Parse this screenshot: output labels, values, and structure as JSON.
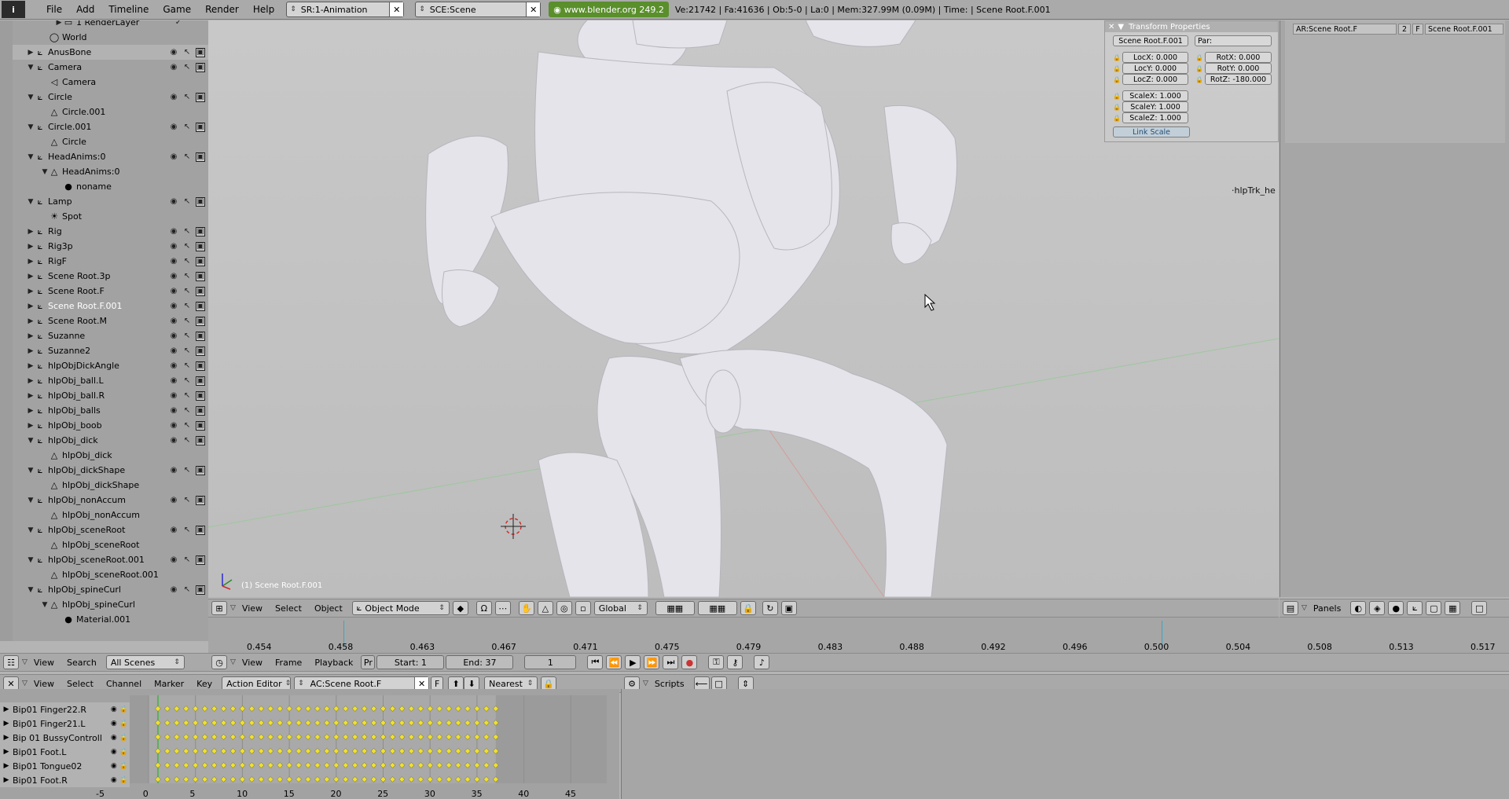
{
  "topbar": {
    "menu": [
      "File",
      "Add",
      "Timeline",
      "Game",
      "Render",
      "Help"
    ],
    "screen_field": "SR:1-Animation",
    "scene_field": "SCE:Scene",
    "site_link": "www.blender.org 249.2",
    "stats": "Ve:21742 | Fa:41636 | Ob:5-0 | La:0  | Mem:327.99M (0.09M)  | Time:  | Scene Root.F.001"
  },
  "outliner": {
    "rows": [
      {
        "name": "1 RenderLayer",
        "indent": 2,
        "icon": "renderlayer-icon",
        "glyph": "▭",
        "tri": "▶",
        "check": "✓"
      },
      {
        "name": "World",
        "indent": 1,
        "icon": "world-icon",
        "glyph": "◯",
        "tri": ""
      },
      {
        "name": "AnusBone",
        "indent": 0,
        "icon": "armature-icon",
        "glyph": "⟀",
        "tri": "▶"
      },
      {
        "name": "Camera",
        "indent": 0,
        "icon": "object-icon",
        "glyph": "⟀",
        "tri": "▼"
      },
      {
        "name": "Camera",
        "indent": 1,
        "icon": "camera-icon",
        "glyph": "◁",
        "tri": ""
      },
      {
        "name": "Circle",
        "indent": 0,
        "icon": "object-icon",
        "glyph": "⟀",
        "tri": "▼"
      },
      {
        "name": "Circle.001",
        "indent": 1,
        "icon": "mesh-icon",
        "glyph": "△",
        "tri": ""
      },
      {
        "name": "Circle.001",
        "indent": 0,
        "icon": "object-icon",
        "glyph": "⟀",
        "tri": "▼"
      },
      {
        "name": "Circle",
        "indent": 1,
        "icon": "mesh-icon",
        "glyph": "△",
        "tri": ""
      },
      {
        "name": "HeadAnims:0",
        "indent": 0,
        "icon": "object-icon",
        "glyph": "⟀",
        "tri": "▼"
      },
      {
        "name": "HeadAnims:0",
        "indent": 1,
        "icon": "mesh-icon",
        "glyph": "△",
        "tri": "▼"
      },
      {
        "name": "noname",
        "indent": 2,
        "icon": "material-icon",
        "glyph": "●",
        "tri": ""
      },
      {
        "name": "Lamp",
        "indent": 0,
        "icon": "object-icon",
        "glyph": "⟀",
        "tri": "▼"
      },
      {
        "name": "Spot",
        "indent": 1,
        "icon": "lamp-icon",
        "glyph": "☀",
        "tri": ""
      },
      {
        "name": "Rig",
        "indent": 0,
        "icon": "armature-icon",
        "glyph": "⟀",
        "tri": "▶"
      },
      {
        "name": "Rig3p",
        "indent": 0,
        "icon": "armature-icon",
        "glyph": "⟀",
        "tri": "▶"
      },
      {
        "name": "RigF",
        "indent": 0,
        "icon": "armature-icon",
        "glyph": "⟀",
        "tri": "▶"
      },
      {
        "name": "Scene Root.3p",
        "indent": 0,
        "icon": "armature-icon",
        "glyph": "⟀",
        "tri": "▶"
      },
      {
        "name": "Scene Root.F",
        "indent": 0,
        "icon": "armature-icon",
        "glyph": "⟀",
        "tri": "▶"
      },
      {
        "name": "Scene Root.F.001",
        "indent": 0,
        "icon": "armature-icon",
        "glyph": "⟀",
        "tri": "▶",
        "selected": true
      },
      {
        "name": "Scene Root.M",
        "indent": 0,
        "icon": "armature-icon",
        "glyph": "⟀",
        "tri": "▶"
      },
      {
        "name": "Suzanne",
        "indent": 0,
        "icon": "object-icon",
        "glyph": "⟀",
        "tri": "▶"
      },
      {
        "name": "Suzanne2",
        "indent": 0,
        "icon": "object-icon",
        "glyph": "⟀",
        "tri": "▶"
      },
      {
        "name": "hlpObjDickAngle",
        "indent": 0,
        "icon": "object-icon",
        "glyph": "⟀",
        "tri": "▶"
      },
      {
        "name": "hlpObj_ball.L",
        "indent": 0,
        "icon": "object-icon",
        "glyph": "⟀",
        "tri": "▶"
      },
      {
        "name": "hlpObj_ball.R",
        "indent": 0,
        "icon": "object-icon",
        "glyph": "⟀",
        "tri": "▶"
      },
      {
        "name": "hlpObj_balls",
        "indent": 0,
        "icon": "object-icon",
        "glyph": "⟀",
        "tri": "▶"
      },
      {
        "name": "hlpObj_boob",
        "indent": 0,
        "icon": "object-icon",
        "glyph": "⟀",
        "tri": "▶"
      },
      {
        "name": "hlpObj_dick",
        "indent": 0,
        "icon": "object-icon",
        "glyph": "⟀",
        "tri": "▼"
      },
      {
        "name": "hlpObj_dick",
        "indent": 1,
        "icon": "mesh-icon",
        "glyph": "△",
        "tri": ""
      },
      {
        "name": "hlpObj_dickShape",
        "indent": 0,
        "icon": "object-icon",
        "glyph": "⟀",
        "tri": "▼"
      },
      {
        "name": "hlpObj_dickShape",
        "indent": 1,
        "icon": "mesh-icon",
        "glyph": "△",
        "tri": ""
      },
      {
        "name": "hlpObj_nonAccum",
        "indent": 0,
        "icon": "object-icon",
        "glyph": "⟀",
        "tri": "▼"
      },
      {
        "name": "hlpObj_nonAccum",
        "indent": 1,
        "icon": "mesh-icon",
        "glyph": "△",
        "tri": ""
      },
      {
        "name": "hlpObj_sceneRoot",
        "indent": 0,
        "icon": "object-icon",
        "glyph": "⟀",
        "tri": "▼"
      },
      {
        "name": "hlpObj_sceneRoot",
        "indent": 1,
        "icon": "mesh-icon",
        "glyph": "△",
        "tri": ""
      },
      {
        "name": "hlpObj_sceneRoot.001",
        "indent": 0,
        "icon": "object-icon",
        "glyph": "⟀",
        "tri": "▼"
      },
      {
        "name": "hlpObj_sceneRoot.001",
        "indent": 1,
        "icon": "mesh-icon",
        "glyph": "△",
        "tri": ""
      },
      {
        "name": "hlpObj_spineCurl",
        "indent": 0,
        "icon": "object-icon",
        "glyph": "⟀",
        "tri": "▼"
      },
      {
        "name": "hlpObj_spineCurl",
        "indent": 1,
        "icon": "mesh-icon",
        "glyph": "△",
        "tri": "▼"
      },
      {
        "name": "Material.001",
        "indent": 2,
        "icon": "material-icon",
        "glyph": "●",
        "tri": ""
      }
    ]
  },
  "viewport": {
    "object_label": "(1) Scene Root.F.001",
    "helper_label": "hlpTrk_he"
  },
  "transform_panel": {
    "title": "Transform Properties",
    "ob_name": "Scene Root.F.001",
    "parent": "Par:",
    "loc": [
      "LocX: 0.000",
      "LocY: 0.000",
      "LocZ: 0.000"
    ],
    "rot": [
      "RotX: 0.000",
      "RotY: 0.000",
      "RotZ: -180.000"
    ],
    "scale": [
      "ScaleX: 1.000",
      "ScaleY: 1.000",
      "ScaleZ: 1.000"
    ],
    "link_scale": "Link Scale"
  },
  "right_panel": {
    "ar_field": "AR:Scene Root.F",
    "users": "2",
    "f": "F",
    "ob_field": "Scene Root.F.001"
  },
  "view3d_header": {
    "menus": [
      "View",
      "Select",
      "Object"
    ],
    "mode": "Object Mode",
    "orientation": "Global"
  },
  "buttons_header": {
    "panels_label": "Panels"
  },
  "ruler": {
    "ticks": [
      "0.454",
      "0.458",
      "0.463",
      "0.467",
      "0.471",
      "0.475",
      "0.479",
      "0.483",
      "0.488",
      "0.492",
      "0.496",
      "0.500",
      "0.504",
      "0.508",
      "0.513",
      "0.517"
    ]
  },
  "outliner_header": {
    "menus": [
      "View",
      "Search"
    ],
    "scenes": "All Scenes"
  },
  "timeline_header": {
    "menus": [
      "View",
      "Frame",
      "Playback"
    ],
    "pr": "Pr",
    "start": "Start: 1",
    "end": "End: 37",
    "current": "1"
  },
  "action_header": {
    "menus": [
      "View",
      "Select",
      "Channel",
      "Marker",
      "Key"
    ],
    "mode": "Action Editor",
    "action": "AC:Scene Root.F",
    "f": "F",
    "interp": "Nearest"
  },
  "scripts_header": {
    "label": "Scripts"
  },
  "action_channels": [
    "Bip01 Finger22.R",
    "Bip01 Finger21.L",
    "Bip 01 BussyControll",
    "Bip01 Foot.L",
    "Bip01 Tongue02",
    "Bip01 Foot.R"
  ],
  "action_ticks": [
    "-5",
    "0",
    "5",
    "10",
    "15",
    "20",
    "25",
    "30",
    "35",
    "40",
    "45"
  ],
  "colors": {
    "keyframe": "#f0e030",
    "site_link_bg": "#5a8f2c",
    "selected_text": "#ffffff"
  }
}
